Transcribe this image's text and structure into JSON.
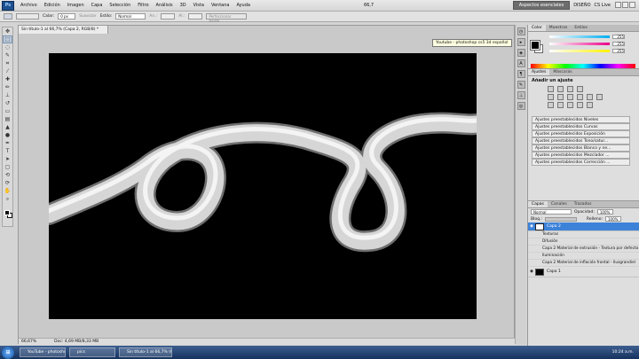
{
  "menubar": {
    "logo": "Ps",
    "items": [
      "Archivo",
      "Edición",
      "Imagen",
      "Capa",
      "Selección",
      "Filtro",
      "Análisis",
      "3D",
      "Vista",
      "Ventana",
      "Ayuda"
    ],
    "zoom": "66,7",
    "workspace": "Aspectos esenciales",
    "diseno": "DISEÑO",
    "cs_live": "CS Live"
  },
  "options": {
    "calar_label": "Calar:",
    "calar_value": "0 px",
    "suavizar": "Suavizar",
    "estilo_label": "Estilo:",
    "estilo_value": "Normal",
    "an_label": "An.:",
    "al_label": "Al.:",
    "refine": "Perfeccionar borde..."
  },
  "document": {
    "tab_title": "Sin título-1 al 66,7% (Capa 2, RGB/8) *",
    "zoom_status": "66,67%",
    "doc_status": "Doc: 4,69 MB/8,33 MB",
    "canvas_color": "#000000"
  },
  "tooltip": "Youtube - photoshop cs5 3d español",
  "color_panel": {
    "tabs": [
      "Color",
      "Muestras",
      "Estilos"
    ],
    "sliders": [
      {
        "color": "cyan",
        "value": "255"
      },
      {
        "color": "magenta",
        "value": "255"
      },
      {
        "color": "yellow",
        "value": "255"
      }
    ]
  },
  "adjust_panel": {
    "tabs": [
      "Ajustes",
      "Máscaras"
    ],
    "title": "Añadir un ajuste",
    "presets": [
      "Ajustes preestablecidos Niveles",
      "Ajustes preestablecidos Curvas",
      "Ajustes preestablecidos Exposición",
      "Ajustes preestablecidos Tono/satur...",
      "Ajustes preestablecidos Blanco y ne...",
      "Ajustes preestablecidos Mezclador ...",
      "Ajustes preestablecidos Corrección ..."
    ]
  },
  "layers_panel": {
    "tabs": [
      "Capas",
      "Canales",
      "Trazados"
    ],
    "blend_mode": "Normal",
    "opacity_label": "Opacidad:",
    "opacity": "100%",
    "lock_label": "Bloq.:",
    "fill_label": "Relleno:",
    "fill": "100%",
    "layers": [
      {
        "name": "Capa 2",
        "active": true
      },
      {
        "name": "Texturas",
        "sub": true
      },
      {
        "name": "Difusión",
        "sub": true
      },
      {
        "name": "Capa 2 Material de extrusión - Textura por defecto",
        "sub": true
      },
      {
        "name": "Iluminación",
        "sub": true
      },
      {
        "name": "Capa 2 Material de inflación frontal - Ilusgrandiel",
        "sub": true
      },
      {
        "name": "Capa 1",
        "active": false
      }
    ]
  },
  "taskbar": {
    "start": "⊞",
    "buttons": [
      "YouTube - photosho...",
      "pics",
      "Sin título-1 al 66,7% (C..."
    ],
    "time": "10:24 a.m."
  }
}
